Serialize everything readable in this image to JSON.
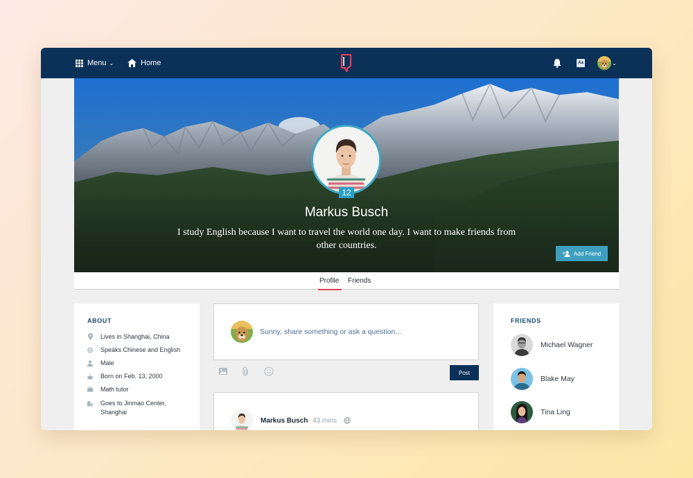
{
  "nav": {
    "menu_label": "Menu",
    "home_label": "Home",
    "aa_label": "Aa",
    "bg_color": "#0b3158"
  },
  "profile": {
    "name": "Markus Busch",
    "level": "12",
    "bio": "I study English because I want to travel the world one day. I want to make friends from other countries.",
    "add_friend_label": "Add Friend"
  },
  "tabs": [
    {
      "label": "Profile",
      "active": true
    },
    {
      "label": "Friends",
      "active": false
    }
  ],
  "about": {
    "title": "ABOUT",
    "items": [
      {
        "icon": "location-pin-icon",
        "text": "Lives in Shanghai, China"
      },
      {
        "icon": "globe-icon",
        "text": "Speaks Chinese and English"
      },
      {
        "icon": "person-icon",
        "text": "Male"
      },
      {
        "icon": "birthday-cake-icon",
        "text": "Born on Feb. 13, 2000"
      },
      {
        "icon": "briefcase-icon",
        "text": "Math tutor"
      },
      {
        "icon": "building-icon",
        "text": "Goes to Jinmao Center, Shanghai"
      }
    ]
  },
  "composer": {
    "placeholder": "Sunny, share something or ask a question...",
    "post_label": "Post"
  },
  "post": {
    "author": "Markus Busch",
    "time": "43 mins"
  },
  "friends": {
    "title": "FRIENDS",
    "items": [
      {
        "name": "Michael Wagner"
      },
      {
        "name": "Blake May"
      },
      {
        "name": "Tina Ling"
      }
    ]
  },
  "colors": {
    "accent": "#2c9fc4",
    "tab_underline": "#e0405a",
    "post_button": "#0b3158"
  }
}
